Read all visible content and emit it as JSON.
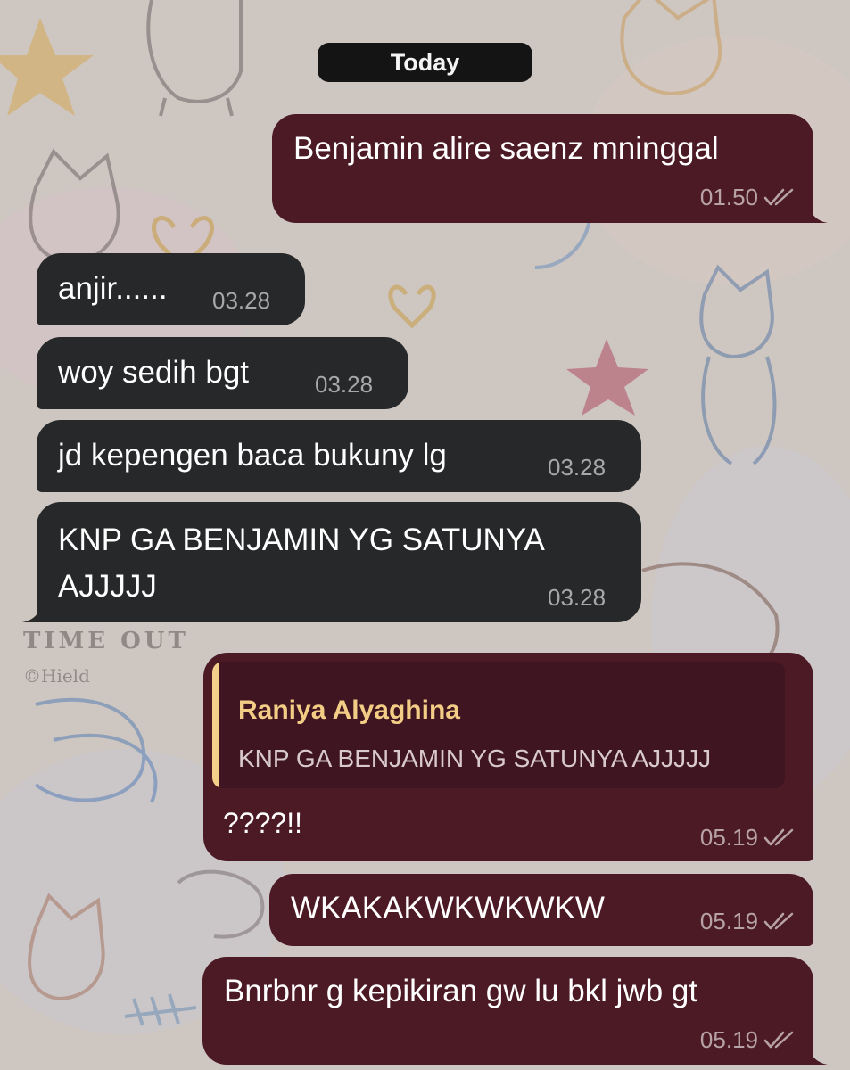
{
  "date_separator": "Today",
  "wallpaper": {
    "watermark": "TIME OUT",
    "credit": "©Hield"
  },
  "messages": [
    {
      "direction": "outgoing",
      "text": "Benjamin alire saenz mninggal",
      "time": "01.50",
      "read": true
    },
    {
      "direction": "incoming",
      "text": "anjir......",
      "time": "03.28"
    },
    {
      "direction": "incoming",
      "text": "woy sedih bgt",
      "time": "03.28"
    },
    {
      "direction": "incoming",
      "text": "jd kepengen baca bukuny lg",
      "time": "03.28"
    },
    {
      "direction": "incoming",
      "lines": [
        "KNP GA BENJAMIN YG SATUNYA",
        "AJJJJJ"
      ],
      "time": "03.28"
    },
    {
      "direction": "outgoing",
      "reply_to": {
        "author": "Raniya Alyaghina",
        "text": "KNP GA BENJAMIN YG SATUNYA AJJJJJ"
      },
      "text": "????!!",
      "time": "05.19",
      "read": true
    },
    {
      "direction": "outgoing",
      "text": "WKAKAKWKWKWKW",
      "time": "05.19",
      "read": true
    },
    {
      "direction": "outgoing",
      "text": "Bnrbnr g kepikiran gw lu bkl jwb gt",
      "time": "05.19",
      "read": true
    }
  ],
  "colors": {
    "outgoing_bubble": "#4c1a25",
    "incoming_bubble": "#262829",
    "reply_accent": "#f3d08a",
    "date_pill": "#141414"
  },
  "icons": {
    "read_receipt": "double-check-icon"
  }
}
